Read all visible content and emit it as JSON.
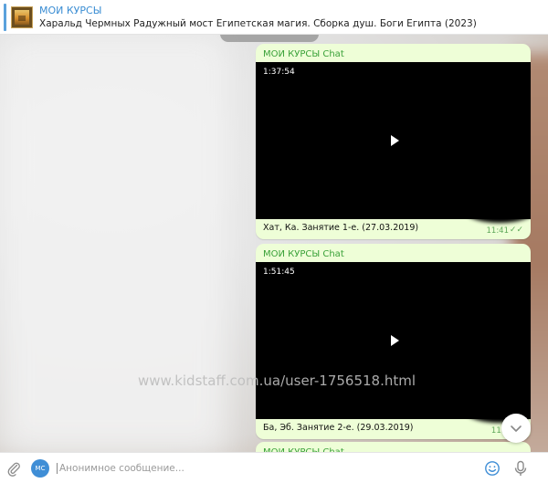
{
  "header": {
    "channel_name": "МОИ КУРСЫ",
    "pinned_text": "Харальд Чермных Радужный мост Египетская магия. Сборка душ. Боги Египта (2023)"
  },
  "chat": {
    "date_pill": "",
    "messages": [
      {
        "sender": "МОИ КУРСЫ Chat",
        "duration": "1:37:54",
        "caption": "Хат, Ка. Занятие 1-е. (27.03.2019)",
        "time": "11:41",
        "status": "✓✓"
      },
      {
        "sender": "МОИ КУРСЫ Chat",
        "duration": "1:51:45",
        "caption": "Ба, Эб. Занятие 2-е. (29.03.2019)",
        "time": "11:4",
        "status": ""
      },
      {
        "sender": "МОИ КУРСЫ Chat"
      }
    ],
    "watermark": "www.kidstaff.com.ua/user-1756518.html"
  },
  "composer": {
    "avatar_initials": "MC",
    "placeholder": "Анонимное сообщение..."
  },
  "icons": {
    "attach": "paperclip-icon",
    "emoji": "smile-icon",
    "mic": "microphone-icon",
    "scroll": "chevron-down-icon",
    "play": "play-icon"
  },
  "colors": {
    "accent": "#3a8dd3",
    "sender": "#3aa139",
    "bubble": "#eefed7"
  }
}
